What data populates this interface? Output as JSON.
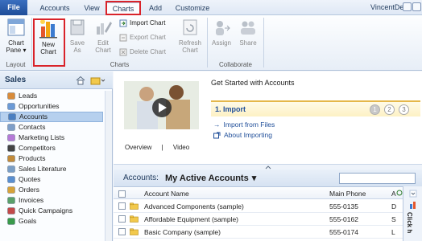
{
  "tabs": {
    "file": "File",
    "accounts": "Accounts",
    "view": "View",
    "charts": "Charts",
    "add": "Add",
    "customize": "Customize"
  },
  "user": "VincentDev",
  "ribbon": {
    "chart_pane": "Chart Pane",
    "chart_pane_2": "Pane",
    "new_chart": "New Chart",
    "new_chart_1": "New",
    "new_chart_2": "Chart",
    "save_as_1": "Save",
    "save_as_2": "As",
    "edit_chart_1": "Edit",
    "edit_chart_2": "Chart",
    "import_chart": "Import Chart",
    "export_chart": "Export Chart",
    "delete_chart": "Delete Chart",
    "refresh_chart_1": "Refresh",
    "refresh_chart_2": "Chart",
    "assign": "Assign",
    "share": "Share",
    "chart_1": "Chart",
    "groups": {
      "layout": "Layout",
      "charts": "Charts",
      "collaborate": "Collaborate"
    }
  },
  "nav": {
    "title": "Sales",
    "items": [
      {
        "label": "Leads",
        "icon": "leads-icon",
        "selected": false
      },
      {
        "label": "Opportunities",
        "icon": "opportunities-icon",
        "selected": false
      },
      {
        "label": "Accounts",
        "icon": "accounts-icon",
        "selected": true
      },
      {
        "label": "Contacts",
        "icon": "contacts-icon",
        "selected": false
      },
      {
        "label": "Marketing Lists",
        "icon": "marketing-lists-icon",
        "selected": false
      },
      {
        "label": "Competitors",
        "icon": "competitors-icon",
        "selected": false
      },
      {
        "label": "Products",
        "icon": "products-icon",
        "selected": false
      },
      {
        "label": "Sales Literature",
        "icon": "sales-literature-icon",
        "selected": false
      },
      {
        "label": "Quotes",
        "icon": "quotes-icon",
        "selected": false
      },
      {
        "label": "Orders",
        "icon": "orders-icon",
        "selected": false
      },
      {
        "label": "Invoices",
        "icon": "invoices-icon",
        "selected": false
      },
      {
        "label": "Quick Campaigns",
        "icon": "quick-campaigns-icon",
        "selected": false
      },
      {
        "label": "Goals",
        "icon": "goals-icon",
        "selected": false
      }
    ]
  },
  "get_started": {
    "title": "Get Started with Accounts",
    "video_tab_overview": "Overview",
    "video_tab_sep": "|",
    "video_tab_video": "Video",
    "import_label": "1. Import",
    "steps": [
      "1",
      "2",
      "3"
    ],
    "links": [
      "Import from Files",
      "About Importing"
    ]
  },
  "grid": {
    "view_label": "Accounts:",
    "view_name": "My Active Accounts",
    "search_value": "",
    "columns": [
      "Account Name",
      "Main Phone",
      "A"
    ],
    "rows": [
      {
        "name": "Advanced Components (sample)",
        "phone": "555-0135",
        "extra": "D"
      },
      {
        "name": "Affordable Equipment (sample)",
        "phone": "555-0162",
        "extra": "S"
      },
      {
        "name": "Basic Company (sample)",
        "phone": "555-0174",
        "extra": "L"
      }
    ]
  },
  "right_strip_label": "Click h",
  "colors": {
    "accent": "#1f4e99",
    "highlight_box": "#d9232a",
    "selected_nav": "#b6d0ee"
  }
}
